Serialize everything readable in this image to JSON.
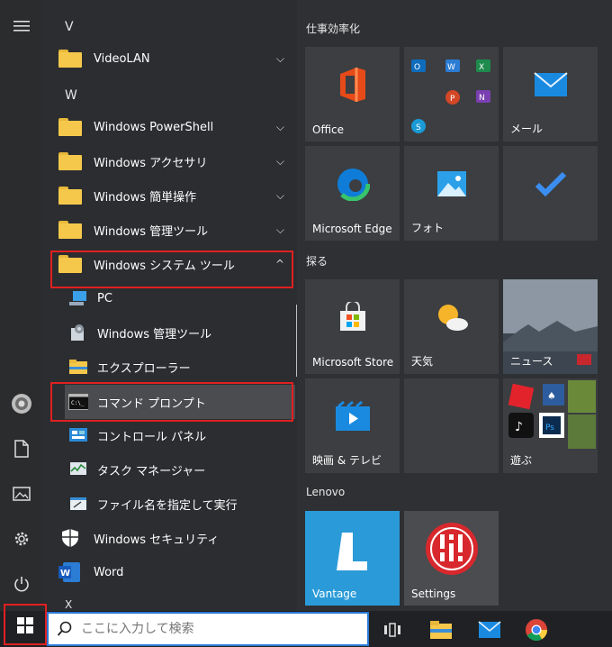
{
  "app_list": {
    "letter_v": "V",
    "letter_w": "W",
    "letter_x": "X",
    "videolan": "VideoLAN",
    "win_powershell": "Windows PowerShell",
    "win_accessories": "Windows アクセサリ",
    "win_ease": "Windows 簡単操作",
    "win_admin": "Windows 管理ツール",
    "win_system": "Windows システム ツール",
    "sub_items": {
      "pc": "PC",
      "admin_tools": "Windows 管理ツール",
      "explorer": "エクスプローラー",
      "cmd": "コマンド プロンプト",
      "control_panel": "コントロール パネル",
      "task_manager": "タスク マネージャー",
      "run": "ファイル名を指定して実行"
    },
    "win_security": "Windows セキュリティ",
    "word": "Word"
  },
  "tiles": {
    "group1_title": "仕事効率化",
    "office": "Office",
    "mail": "メール",
    "edge": "Microsoft Edge",
    "photos": "フォト",
    "group2_title": "探る",
    "store": "Microsoft Store",
    "weather": "天気",
    "news": "ニュース",
    "movies": "映画 & テレビ",
    "play": "遊ぶ",
    "group3_title": "Lenovo",
    "vantage": "Vantage",
    "settings": "Settings"
  },
  "taskbar": {
    "search_placeholder": "ここに入力して検索"
  },
  "colors": {
    "highlight_red": "#e02020",
    "search_border": "#2a7ad6",
    "folder_yellow": "#f5c84c"
  }
}
